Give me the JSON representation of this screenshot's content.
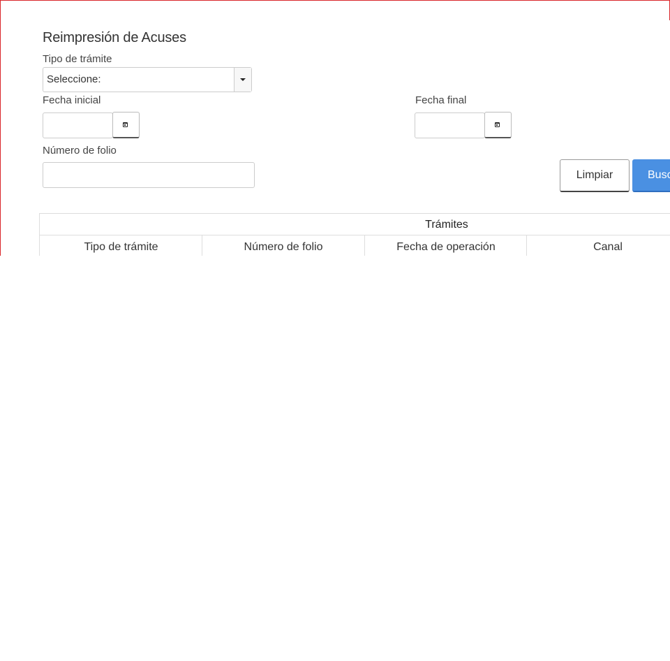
{
  "page": {
    "title": "Reimpresión de Acuses"
  },
  "form": {
    "tipo_tramite": {
      "label": "Tipo de trámite",
      "selected": "Seleccione:"
    },
    "fecha_inicial": {
      "label": "Fecha inicial",
      "value": ""
    },
    "fecha_final": {
      "label": "Fecha final",
      "value": ""
    },
    "numero_folio": {
      "label": "Número de folio",
      "value": ""
    }
  },
  "buttons": {
    "clear_label": "Limpiar",
    "search_label": "Buscar"
  },
  "table": {
    "caption": "Trámites",
    "columns": [
      "Tipo de trámite",
      "Número de folio",
      "Fecha de operación",
      "Canal"
    ]
  },
  "icons": {
    "calendar": "calendar-icon",
    "caret": "chevron-down-icon"
  },
  "colors": {
    "accent": "#4a90e2",
    "frame_border": "#d9262a"
  }
}
